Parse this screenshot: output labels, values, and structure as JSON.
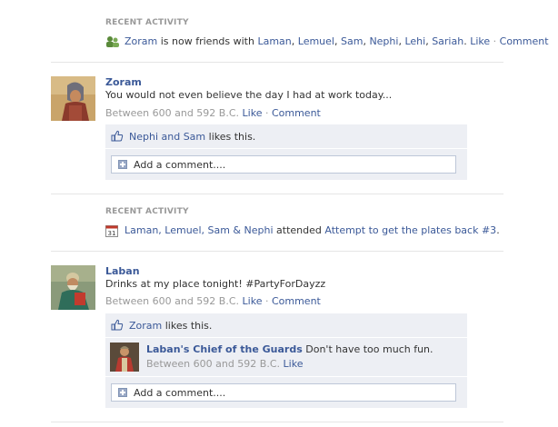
{
  "activity1": {
    "label": "RECENT ACTIVITY",
    "actor": "Zoram",
    "text": " is now friends with ",
    "friends": [
      "Laman",
      "Lemuel",
      "Sam",
      "Nephi",
      "Lehi",
      "Sariah"
    ],
    "like": "Like",
    "comment": "Comment"
  },
  "post1": {
    "author": "Zoram",
    "message": "You would not even believe the day I had at work today...",
    "timestamp": "Between 600 and 592 B.C.",
    "like": "Like",
    "comment": "Comment",
    "likers": "Nephi and Sam",
    "likes_text": " likes this.",
    "comment_placeholder": "Add a comment...."
  },
  "activity2": {
    "label": "RECENT ACTIVITY",
    "calendar_day": "31",
    "attendees": "Laman, Lemuel, Sam & Nephi",
    "attended_text": " attended ",
    "event": "Attempt to get the plates back #3",
    "period": "."
  },
  "post2": {
    "author": "Laban",
    "message": "Drinks at my place tonight! #PartyForDayzz",
    "timestamp": "Between 600 and 592 B.C.",
    "like": "Like",
    "comment": "Comment",
    "likers": "Zoram",
    "likes_text": " likes this.",
    "reply": {
      "author": "Laban's Chief of the Guards",
      "text": " Don't have too much fun.",
      "timestamp": "Between 600 and 592 B.C.",
      "like": "Like"
    },
    "comment_placeholder": "Add a comment...."
  }
}
